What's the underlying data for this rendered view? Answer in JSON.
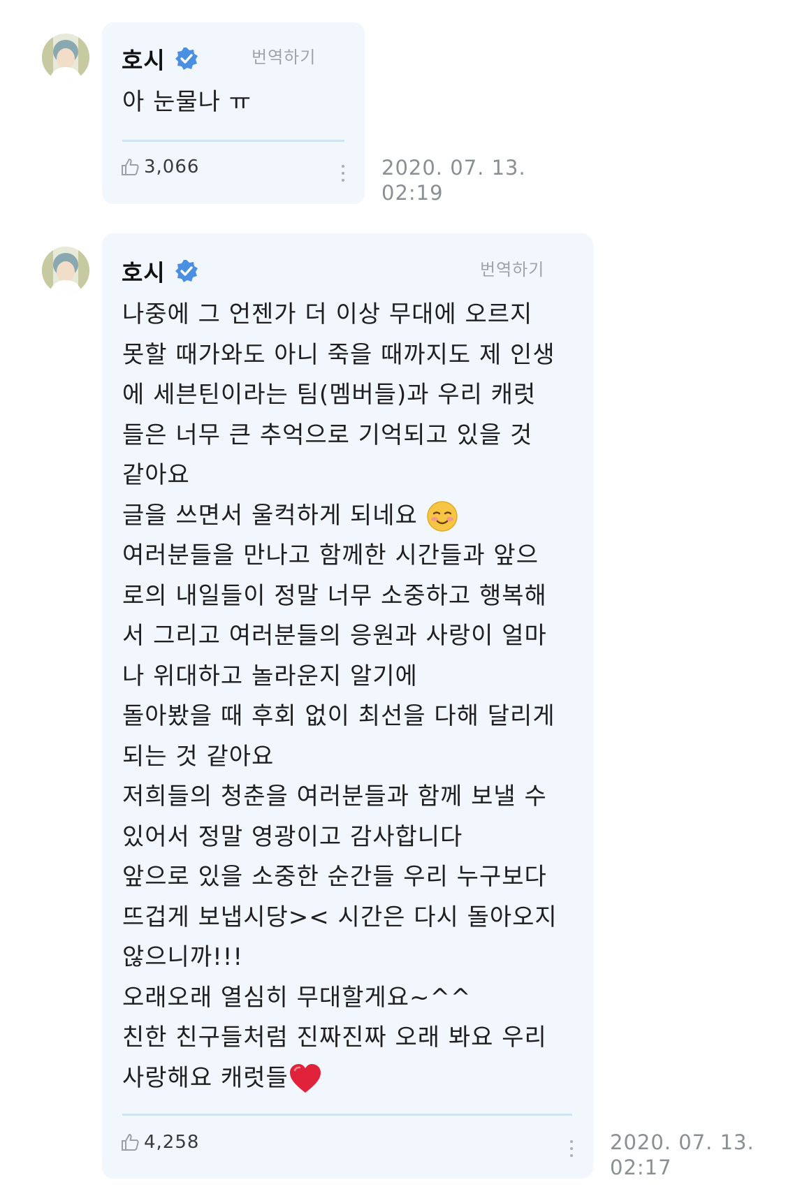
{
  "messages": [
    {
      "author": "호시",
      "translate_label": "번역하기",
      "lines": [
        "아 눈물나 ㅠ"
      ],
      "likes": "3,066",
      "date": "2020. 07. 13.",
      "time": "02:19"
    },
    {
      "author": "호시",
      "translate_label": "번역하기",
      "lines": [
        "나중에 그 언젠가 더 이상 무대에 오르지",
        "못할 때가와도 아니 죽을 때까지도 제 인생",
        "에 세븐틴이라는 팀(멤버들)과 우리 캐럿",
        "들은 너무 큰 추억으로 기억되고 있을 것",
        "같아요",
        "글을 쓰면서 울컥하게 되네요",
        "여러분들을 만나고 함께한 시간들과 앞으",
        "로의 내일들이 정말 너무 소중하고 행복해",
        "서 그리고 여러분들의 응원과 사랑이 얼마",
        "나 위대하고 놀라운지 알기에",
        "돌아봤을 때 후회 없이 최선을 다해 달리게",
        "되는 것 같아요",
        "저희들의 청춘을 여러분들과 함께 보낼 수",
        "있어서 정말 영광이고 감사합니다",
        "앞으로 있을 소중한 순간들 우리 누구보다",
        "뜨겁게 보냅시당>< 시간은 다시 돌아오지",
        "않으니까!!!",
        "오래오래 열심히 무대할게요~^^",
        "친한 친구들처럼 진짜진짜 오래 봐요 우리",
        "사랑해요 캐럿들"
      ],
      "likes": "4,258",
      "date": "2020. 07. 13.",
      "time": "02:17"
    }
  ],
  "icons": {
    "verified": "verified-badge-icon",
    "like": "thumbs-up-icon",
    "more": "more-vertical-icon",
    "emoji_1": "smiling-face-icon",
    "emoji_2": "red-heart-icon"
  },
  "colors": {
    "bubble": "#f1f7fd",
    "verified": "#4a90e2",
    "divider": "#cfe4f1",
    "muted": "#9ea4aa",
    "heart": "#e0233a"
  }
}
